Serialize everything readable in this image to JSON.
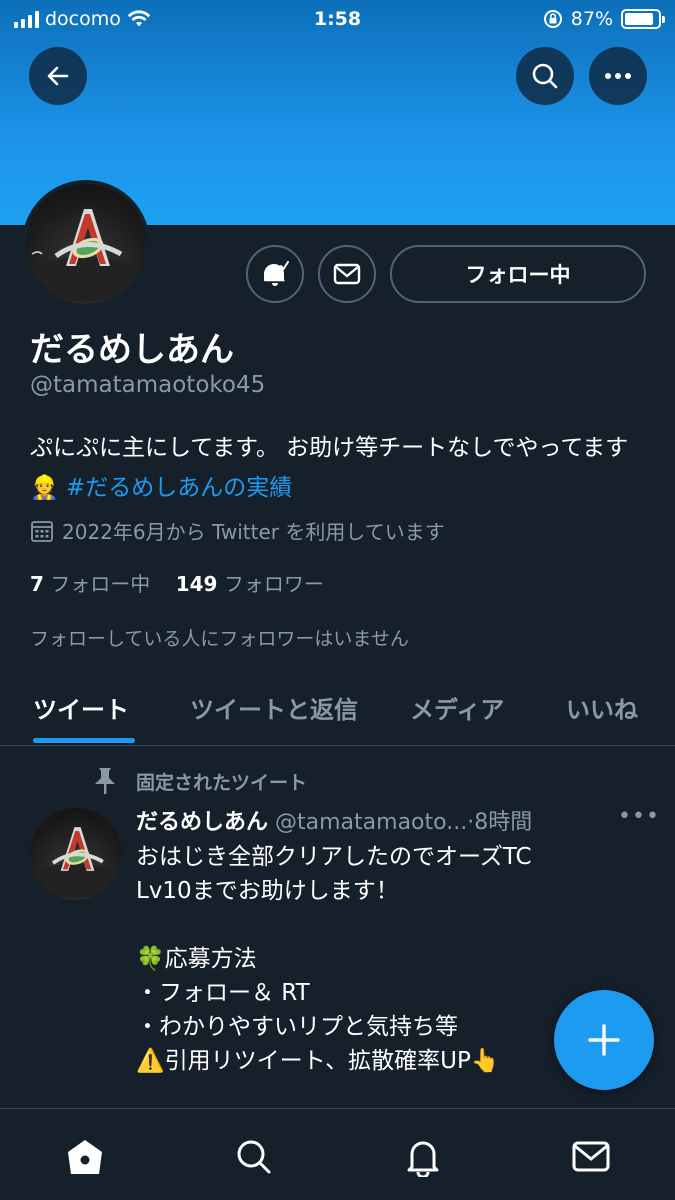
{
  "status_bar": {
    "carrier": "docomo",
    "time": "1:58",
    "battery_percent": "87%",
    "battery_level": 0.87,
    "icons": [
      "signal-icon",
      "wifi-icon",
      "orientation-lock-icon",
      "battery-icon"
    ]
  },
  "header": {
    "back_icon": "arrow-left-icon",
    "search_icon": "search-icon",
    "more_icon": "more-dots-icon"
  },
  "profile": {
    "display_name": "だるめしあん",
    "handle": "@tamatamaotoko45",
    "bio_text": "ぷにぷに主にしてます。 お助け等チートなしでやってます👷",
    "bio_hashtag": "#だるめしあんの実績",
    "joined": "2022年6月から Twitter を利用しています",
    "following_count": "7",
    "following_label": "フォロー中",
    "followers_count": "149",
    "followers_label": "フォロワー",
    "followers_you_know": "フォローしている人にフォロワーはいません",
    "follow_button_label": "フォロー中"
  },
  "tabs": [
    {
      "label": "ツイート",
      "active": true
    },
    {
      "label": "ツイートと返信",
      "active": false
    },
    {
      "label": "メディア",
      "active": false
    },
    {
      "label": "いいね",
      "active": false
    }
  ],
  "pinned_tweet": {
    "pinned_label": "固定されたツイート",
    "author_name": "だるめしあん",
    "author_handle": "@tamatamaoto...",
    "separator": "·",
    "time": "8時間",
    "more": "•••",
    "lines": [
      "おはじき全部クリアしたのでオーズTC",
      "Lv10までお助けします！",
      "",
      "🍀応募方法",
      "・フォロー＆ RT",
      "・わかりやすいリプと気持ち等",
      "⚠️引用リツイート、拡散確率UP👆"
    ]
  },
  "colors": {
    "background": "#15202b",
    "accent": "#1d9bf0",
    "banner": "#1ea1f2",
    "secondary_text": "#8b98a5",
    "border": "#536471"
  },
  "bottom_nav": [
    "home-icon",
    "search-icon",
    "notifications-icon",
    "messages-icon"
  ]
}
